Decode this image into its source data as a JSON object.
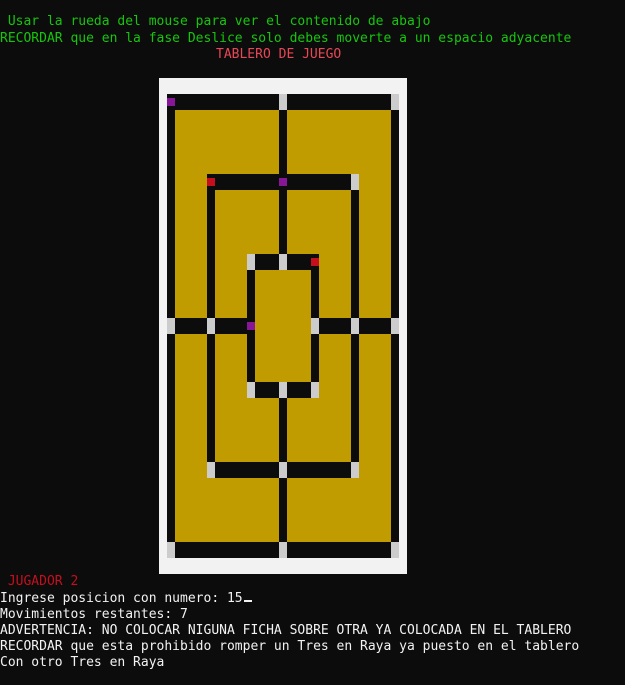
{
  "header": {
    "line1": " Usar la rueda del mouse para ver el contenido de abajo",
    "line2": "RECORDAR que en la fase Deslice solo debes moverte a un espacio adyacente",
    "board_title": "TABLERO DE JUEGO"
  },
  "colors": {
    "background": "#0c0c0c",
    "board_gold": "#c19c00",
    "board_lines": "#0c0c0c",
    "board_frame": "#f2f2f2",
    "node_empty": "#cccccc",
    "piece_player1": "#c50f1f",
    "piece_player2": "#881798"
  },
  "board": {
    "nodes": [
      {
        "pos": "outer-top-left",
        "state": "player2"
      },
      {
        "pos": "outer-top-mid",
        "state": "empty"
      },
      {
        "pos": "outer-top-right",
        "state": "empty"
      },
      {
        "pos": "middle-top-left",
        "state": "player1"
      },
      {
        "pos": "middle-top-mid",
        "state": "player2"
      },
      {
        "pos": "middle-top-right",
        "state": "empty"
      },
      {
        "pos": "inner-top-left",
        "state": "empty"
      },
      {
        "pos": "inner-top-mid",
        "state": "empty"
      },
      {
        "pos": "inner-top-right",
        "state": "player1"
      },
      {
        "pos": "outer-mid-left",
        "state": "empty"
      },
      {
        "pos": "middle-mid-left",
        "state": "empty"
      },
      {
        "pos": "inner-mid-left",
        "state": "player2"
      },
      {
        "pos": "inner-mid-right",
        "state": "empty"
      },
      {
        "pos": "middle-mid-right",
        "state": "empty"
      },
      {
        "pos": "outer-mid-right",
        "state": "empty"
      },
      {
        "pos": "inner-bottom-left",
        "state": "empty"
      },
      {
        "pos": "inner-bottom-mid",
        "state": "empty"
      },
      {
        "pos": "inner-bottom-right",
        "state": "empty"
      },
      {
        "pos": "middle-bottom-left",
        "state": "empty"
      },
      {
        "pos": "middle-bottom-mid",
        "state": "empty"
      },
      {
        "pos": "middle-bottom-right",
        "state": "empty"
      },
      {
        "pos": "outer-bottom-left",
        "state": "empty"
      },
      {
        "pos": "outer-bottom-mid",
        "state": "empty"
      },
      {
        "pos": "outer-bottom-right",
        "state": "empty"
      }
    ]
  },
  "footer": {
    "player_label": " JUGADOR 2",
    "prompt": "Ingrese posicion con numero: ",
    "input_value": "15",
    "moves_remaining": "Movimientos restantes: 7",
    "warning": "ADVERTENCIA: NO COLOCAR NIGUNA FICHA SOBRE OTRA YA COLOCADA EN EL TABLERO",
    "reminder1": "RECORDAR que esta prohibido romper un Tres en Raya ya puesto en el tablero",
    "reminder2": "Con otro Tres en Raya"
  }
}
